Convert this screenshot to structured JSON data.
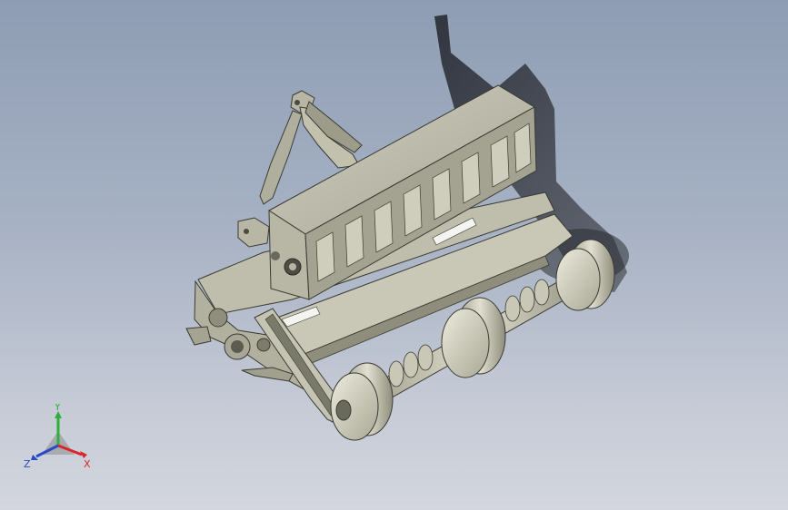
{
  "view": {
    "background_top": "#8e9db4",
    "background_bottom": "#d3d6de",
    "model_name": "",
    "model_color": "#b9b8a6"
  },
  "triad": {
    "x_label": "X",
    "y_label": "Y",
    "z_label": "Z",
    "x_color": "#d8262b",
    "y_color": "#2fae3d",
    "z_color": "#2a49c9"
  }
}
